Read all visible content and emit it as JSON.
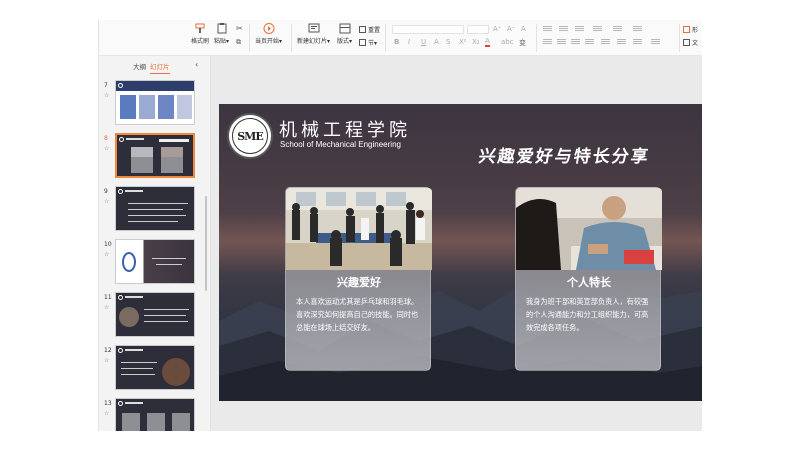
{
  "ribbon": {
    "format_painter": "格式刷",
    "paste": "粘贴",
    "cut_icon": "scissors-icon",
    "copy_icon": "copy-icon",
    "start_from_current": "当页开始",
    "new_slide": "新建幻灯片",
    "layout": "版式",
    "reset": "重置",
    "section": "节",
    "font_bold": "B",
    "font_italic": "I",
    "font_underline": "U",
    "font_strike": "A",
    "font_shadow": "S",
    "superscript": "X²",
    "subscript": "X₂",
    "font_color": "A",
    "text_effects": "abc",
    "more_format": "变",
    "grow_font": "A⁺",
    "shrink_font": "A⁻",
    "clear_format": "A",
    "char_spacing": "ab",
    "para_label_1": "形",
    "para_label_2": "文"
  },
  "sidebar": {
    "tabs": [
      "大纲",
      "幻灯片"
    ],
    "active_tab": 1,
    "collapse_icon": "chevron-left-icon",
    "slides": [
      {
        "num": "7"
      },
      {
        "num": "8",
        "active": true
      },
      {
        "num": "9"
      },
      {
        "num": "10"
      },
      {
        "num": "11"
      },
      {
        "num": "12"
      },
      {
        "num": "13"
      }
    ]
  },
  "slide": {
    "school_cn": "机械工程学院",
    "school_en": "School of Mechanical Engineering",
    "logo_text": "SME",
    "title": "兴趣爱好与特长分享",
    "cards": [
      {
        "title": "兴趣爱好",
        "text": "本人喜欢运动尤其是乒乓球和羽毛球。喜欢深究如何提高自己的技能。同时也总能在球场上结交好友。"
      },
      {
        "title": "个人特长",
        "text": "我身为班干部和英宣部负责人，有较强的个人沟通能力和分工组织能力，可高效完成各项任务。"
      }
    ]
  },
  "colors": {
    "accent": "#e8703a"
  }
}
